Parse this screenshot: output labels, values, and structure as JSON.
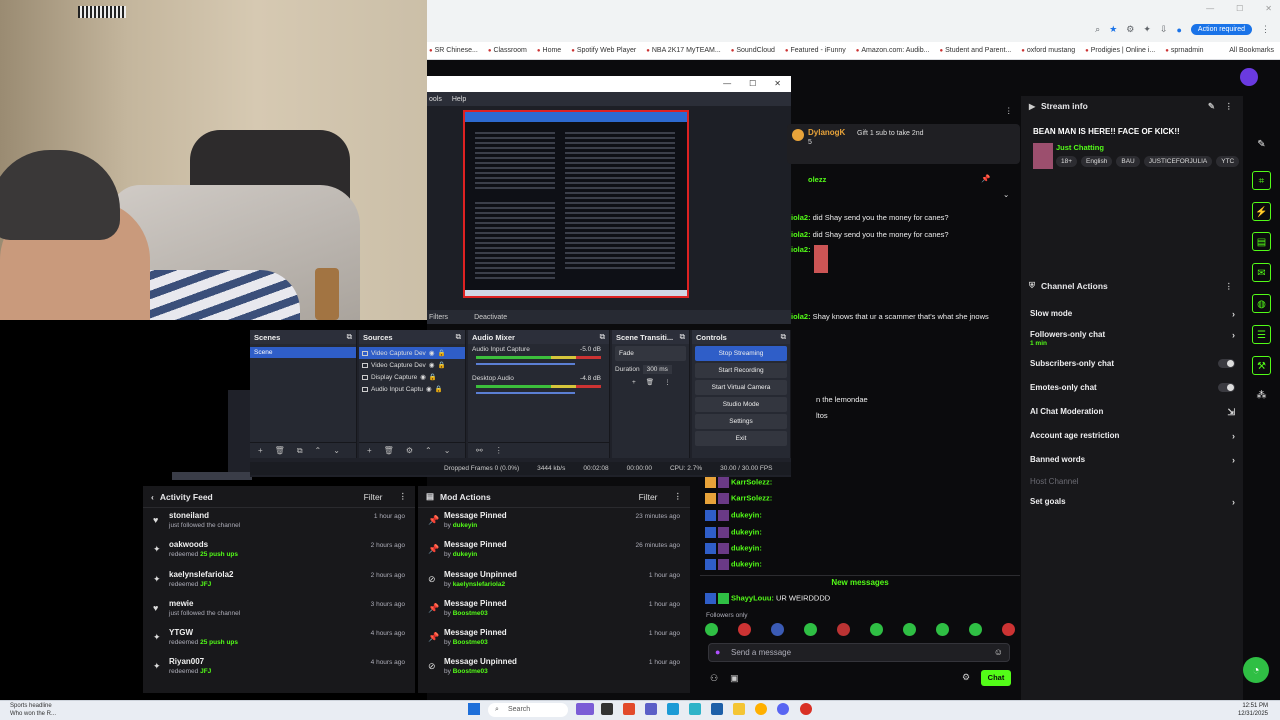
{
  "browser": {
    "bookmarks": [
      "SR Chinese...",
      "Classroom",
      "Home",
      "Spotify Web Player",
      "NBA 2K17 MyTEAM...",
      "SoundCloud",
      "Featured - iFunny",
      "Amazon.com: Audib...",
      "Student and Parent...",
      "oxford mustang",
      "Prodigies | Online i...",
      "sprnadmin"
    ],
    "all_bookmarks": "All Bookmarks",
    "action_required": "Action required"
  },
  "obs": {
    "menu": [
      "ools",
      "Help"
    ],
    "preview_bar": [
      "Filters",
      "Deactivate"
    ],
    "docks": {
      "scenes": {
        "title": "Scenes",
        "items": [
          "Scene"
        ]
      },
      "sources": {
        "title": "Sources",
        "items": [
          "Video Capture Dev",
          "Video Capture Dev",
          "Display Capture",
          "Audio Input Captu"
        ]
      },
      "mixer": {
        "title": "Audio Mixer",
        "channels": [
          {
            "name": "Audio Input Capture",
            "db": "-5.0 dB"
          },
          {
            "name": "Desktop Audio",
            "db": "-4.8 dB"
          }
        ]
      },
      "transitions": {
        "title": "Scene Transiti...",
        "type": "Fade",
        "duration_label": "Duration",
        "duration": "300 ms"
      },
      "controls": {
        "title": "Controls",
        "buttons": [
          "Stop Streaming",
          "Start Recording",
          "Start Virtual Camera",
          "Studio Mode",
          "Settings",
          "Exit"
        ]
      }
    },
    "status": {
      "dropped": "Dropped Frames 0 (0.0%)",
      "bitrate": "3444 kb/s",
      "stream_time": "00:02:08",
      "rec_time": "00:00:00",
      "cpu": "CPU: 2.7%",
      "fps": "30.00 / 30.00 FPS"
    }
  },
  "activity_feed": {
    "title": "Activity Feed",
    "filter": "Filter",
    "items": [
      {
        "icon": "heart-icon",
        "name": "stoneiland",
        "detail": "just followed the channel",
        "highlight": "",
        "time": "1 hour ago"
      },
      {
        "icon": "points-icon",
        "name": "oakwoods",
        "detail": "redeemed",
        "highlight": "25 push ups",
        "time": "2 hours ago"
      },
      {
        "icon": "points-icon",
        "name": "kaelynslefariola2",
        "detail": "redeemed",
        "highlight": "JFJ",
        "time": "2 hours ago"
      },
      {
        "icon": "heart-icon",
        "name": "mewie",
        "detail": "just followed the channel",
        "highlight": "",
        "time": "3 hours ago"
      },
      {
        "icon": "points-icon",
        "name": "YTGW",
        "detail": "redeemed",
        "highlight": "25 push ups",
        "time": "4 hours ago"
      },
      {
        "icon": "points-icon",
        "name": "Riyan007",
        "detail": "redeemed",
        "highlight": "JFJ",
        "time": "4 hours ago"
      }
    ]
  },
  "mod_actions": {
    "title": "Mod Actions",
    "filter": "Filter",
    "items": [
      {
        "icon": "pin-icon",
        "name": "Message Pinned",
        "detail": "by",
        "highlight": "dukeyin",
        "time": "23 minutes ago"
      },
      {
        "icon": "pin-icon",
        "name": "Message Pinned",
        "detail": "by",
        "highlight": "dukeyin",
        "time": "26 minutes ago"
      },
      {
        "icon": "unpin-icon",
        "name": "Message Unpinned",
        "detail": "by",
        "highlight": "kaelynslefariola2",
        "time": "1 hour ago"
      },
      {
        "icon": "pin-icon",
        "name": "Message Pinned",
        "detail": "by",
        "highlight": "Boostme03",
        "time": "1 hour ago"
      },
      {
        "icon": "pin-icon",
        "name": "Message Pinned",
        "detail": "by",
        "highlight": "Boostme03",
        "time": "1 hour ago"
      },
      {
        "icon": "unpin-icon",
        "name": "Message Unpinned",
        "detail": "by",
        "highlight": "Boostme03",
        "time": "1 hour ago"
      }
    ]
  },
  "chat": {
    "pinned_user": "DylanogK",
    "pinned_count": "5",
    "pinned_text": "Gift 1 sub to take 2nd",
    "pinned_by": "olezz",
    "lines": [
      {
        "user": "iola2:",
        "text": " did Shay send you the money for canes?"
      },
      {
        "user": "iola2:",
        "text": " did Shay send you the money for canes?"
      },
      {
        "user": "iola2:",
        "text": ""
      },
      {
        "user": "iola2:",
        "text": " Shay knows that ur a scammer that's what she jnows"
      },
      {
        "user": "",
        "text": "n the lemondae"
      },
      {
        "user": "",
        "text": "ltos"
      }
    ],
    "recent": [
      {
        "user": "KarrSolezz:",
        "text": ""
      },
      {
        "user": "KarrSolezz:",
        "text": ""
      },
      {
        "user": "dukeyin:",
        "text": ""
      },
      {
        "user": "dukeyin:",
        "text": ""
      },
      {
        "user": "dukeyin:",
        "text": ""
      },
      {
        "user": "dukeyin:",
        "text": ""
      }
    ],
    "new_messages": "New messages",
    "last_user": "ShayyLouu:",
    "last_text": " UR WEIRDDDD",
    "followers_only": "Followers only",
    "input_placeholder": "Send a message",
    "send": "Chat"
  },
  "stream_info": {
    "header": "Stream info",
    "title": "BEAN MAN IS HERE!! FACE OF KICK!!",
    "category": "Just Chatting",
    "tags": [
      "18+",
      "English",
      "BAU",
      "JUSTICEFORJULIA",
      "YTC"
    ]
  },
  "channel_actions": {
    "header": "Channel Actions",
    "rows": [
      {
        "label": "Slow mode",
        "sub": "",
        "control": "chevron"
      },
      {
        "label": "Followers-only chat",
        "sub": "1 min",
        "control": "chevron"
      },
      {
        "label": "Subscribers-only chat",
        "sub": "",
        "control": "toggle"
      },
      {
        "label": "Emotes-only chat",
        "sub": "",
        "control": "toggle"
      },
      {
        "label": "AI Chat Moderation",
        "sub": "",
        "control": "external"
      },
      {
        "label": "Account age restriction",
        "sub": "",
        "control": "chevron"
      },
      {
        "label": "Banned words",
        "sub": "",
        "control": "chevron"
      },
      {
        "label": "Host Channel",
        "sub": "",
        "control": "none"
      },
      {
        "label": "Set goals",
        "sub": "",
        "control": "chevron"
      }
    ]
  },
  "taskbar": {
    "news_title": "Sports headline",
    "news_sub": "Who won the R...",
    "search": "Search",
    "time": "12:51 PM",
    "date": "12/31/2025"
  },
  "colors": {
    "kick_green": "#53fc18",
    "panel": "#18181b",
    "obs_blue": "#2f5ec8"
  }
}
